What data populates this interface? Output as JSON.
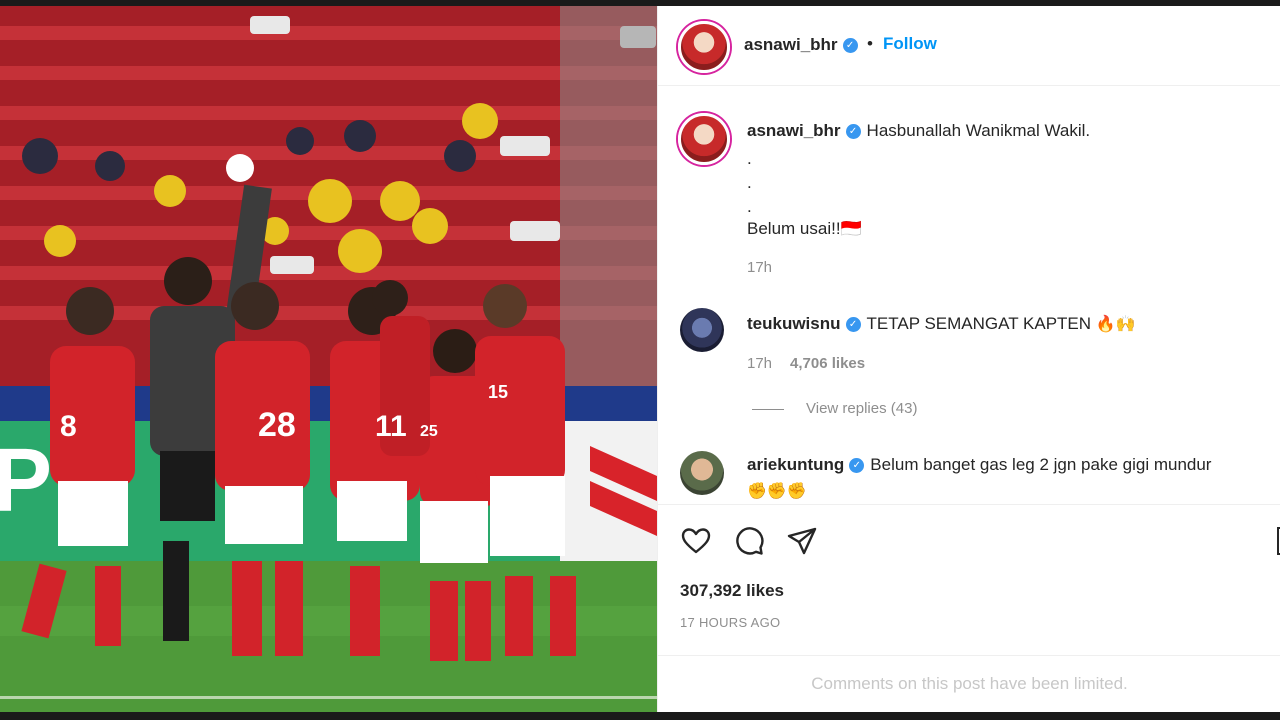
{
  "post": {
    "author": "asnawi_bhr",
    "follow_label": "Follow",
    "separator": "•",
    "more_label": "•",
    "caption": {
      "username": "asnawi_bhr",
      "text": "Hasbunallah Wanikmal Wakil.",
      "dots": [
        ".",
        ".",
        "."
      ],
      "text2": "Belum usai!!🇮🇩",
      "time": "17h"
    },
    "comments": [
      {
        "username": "teukuwisnu",
        "text": "TETAP SEMANGAT KAPTEN",
        "emoji": "🔥🙌",
        "time": "17h",
        "likes": "4,706 likes",
        "replies": "View replies (43)"
      },
      {
        "username": "ariekuntung",
        "text": "Belum banget gas leg 2 jgn pake gigi mundur",
        "emoji": "✊✊✊"
      }
    ],
    "likes": "307,392 likes",
    "timestamp": "17 HOURS AGO",
    "limited_notice": "Comments on this post have been limited."
  },
  "photo": {
    "jersey_numbers": [
      "8",
      "28",
      "11",
      "25",
      "15"
    ],
    "ad_board_letter": "P",
    "colors": {
      "kit_red": "#d2232a",
      "keeper_grey": "#3c3c3c",
      "pitch": "#4f9a3a",
      "stands": "#b8262b"
    }
  },
  "icons": {
    "heart": "heart-icon",
    "comment": "comment-icon",
    "share": "share-icon",
    "bookmark": "bookmark-icon",
    "verified": "verified-badge-icon"
  },
  "colors": {
    "link_blue": "#0095f6",
    "verified_blue": "#3897f0",
    "text": "#262626",
    "muted": "#8e8e8e"
  }
}
